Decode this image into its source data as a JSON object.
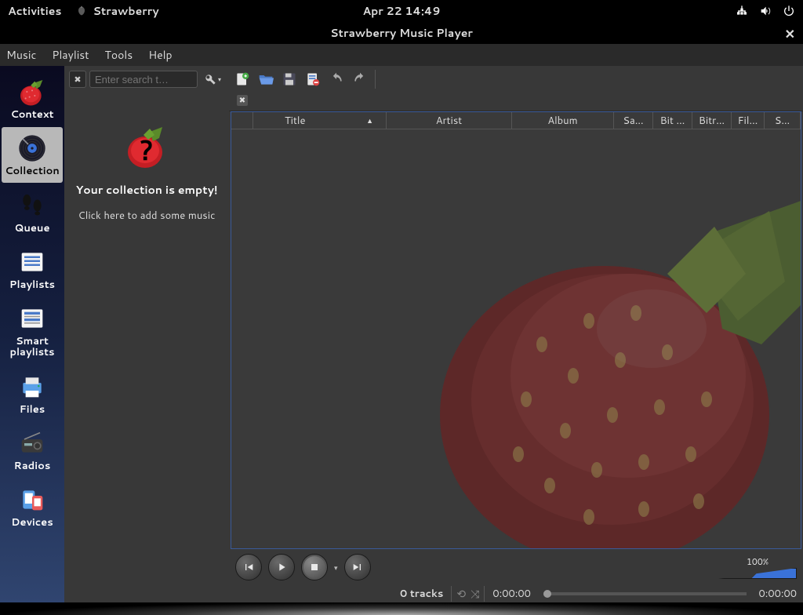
{
  "gnome": {
    "activities": "Activities",
    "app_name": "Strawberry",
    "datetime": "Apr 22  14:49"
  },
  "window": {
    "title": "Strawberry Music Player"
  },
  "menu": {
    "music": "Music",
    "playlist": "Playlist",
    "tools": "Tools",
    "help": "Help"
  },
  "sidebar": {
    "items": [
      {
        "label": "Context"
      },
      {
        "label": "Collection"
      },
      {
        "label": "Queue"
      },
      {
        "label": "Playlists"
      },
      {
        "label": "Smart playlists"
      },
      {
        "label": "Files"
      },
      {
        "label": "Radios"
      },
      {
        "label": "Devices"
      }
    ]
  },
  "collection": {
    "search_placeholder": "Enter search t…",
    "empty_title": "Your collection is empty!",
    "empty_sub": "Click here to add some music"
  },
  "columns": {
    "c0": "",
    "c1": "Title",
    "c2": "Artist",
    "c3": "Album",
    "c4": "Sa…",
    "c5": "Bit …",
    "c6": "Bitr…",
    "c7": "Fil…",
    "c8": "S…"
  },
  "controls": {
    "volume_label": "100%"
  },
  "status": {
    "tracks": "0 tracks",
    "time_l": "0:00:00",
    "time_r": "0:00:00"
  }
}
